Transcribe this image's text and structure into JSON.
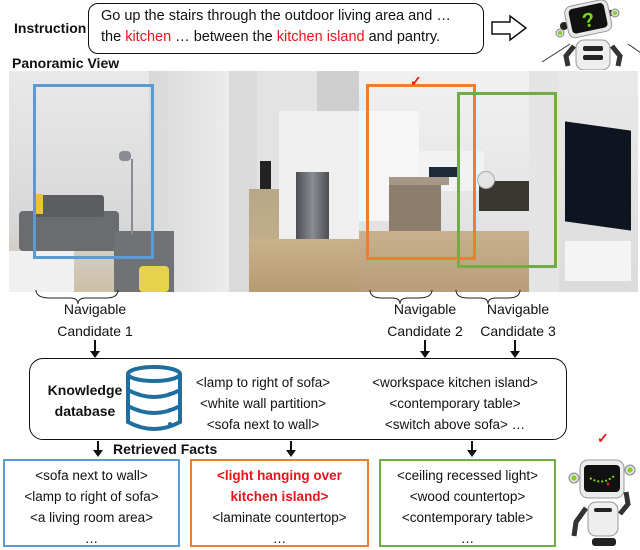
{
  "instruction": {
    "label": "Instruction",
    "line1": "Go up the stairs through the outdoor living area and …",
    "line2_parts": [
      {
        "text": "the ",
        "highlight": false
      },
      {
        "text": "kitchen",
        "highlight": true
      },
      {
        "text": " … between the ",
        "highlight": false
      },
      {
        "text": "kitchen island",
        "highlight": true
      },
      {
        "text": " and pantry.",
        "highlight": false
      }
    ]
  },
  "panorama": {
    "label": "Panoramic View",
    "selected_mark": "✓"
  },
  "candidates": [
    {
      "line1": "Navigable",
      "line2": "Candidate 1",
      "color": "#5b9bd5"
    },
    {
      "line1": "Navigable",
      "line2": "Candidate 2",
      "color": "#ed7d31"
    },
    {
      "line1": "Navigable",
      "line2": "Candidate 3",
      "color": "#70ad47"
    }
  ],
  "knowledge_db": {
    "label_line1": "Knowledge",
    "label_line2": "database",
    "icon": "database-icon",
    "facts_left": [
      "<lamp to right of sofa>",
      "<white wall partition>",
      "<sofa next to wall>"
    ],
    "facts_right": [
      "<workspace kitchen island>",
      "<contemporary table>",
      "<switch above sofa> …"
    ]
  },
  "retrieved": {
    "label": "Retrieved Facts",
    "boxes": [
      {
        "facts": [
          "<sofa next to wall>",
          "<lamp to right of sofa>",
          "<a living room area>",
          "…"
        ],
        "highlight_count": 0
      },
      {
        "facts": [
          "<light hanging over",
          "kitchen island>",
          "<laminate countertop>",
          "…"
        ],
        "highlight_count": 2
      },
      {
        "facts": [
          "<ceiling recessed light>",
          "<wood countertop>",
          "<contemporary table>",
          "…"
        ],
        "highlight_count": 0
      }
    ],
    "selected_mark": "✓"
  },
  "colors": {
    "accent_red": "#e8141b",
    "candidate1": "#5b9bd5",
    "candidate2": "#ed7d31",
    "candidate3": "#70ad47",
    "db_blue": "#1f6e9e"
  }
}
